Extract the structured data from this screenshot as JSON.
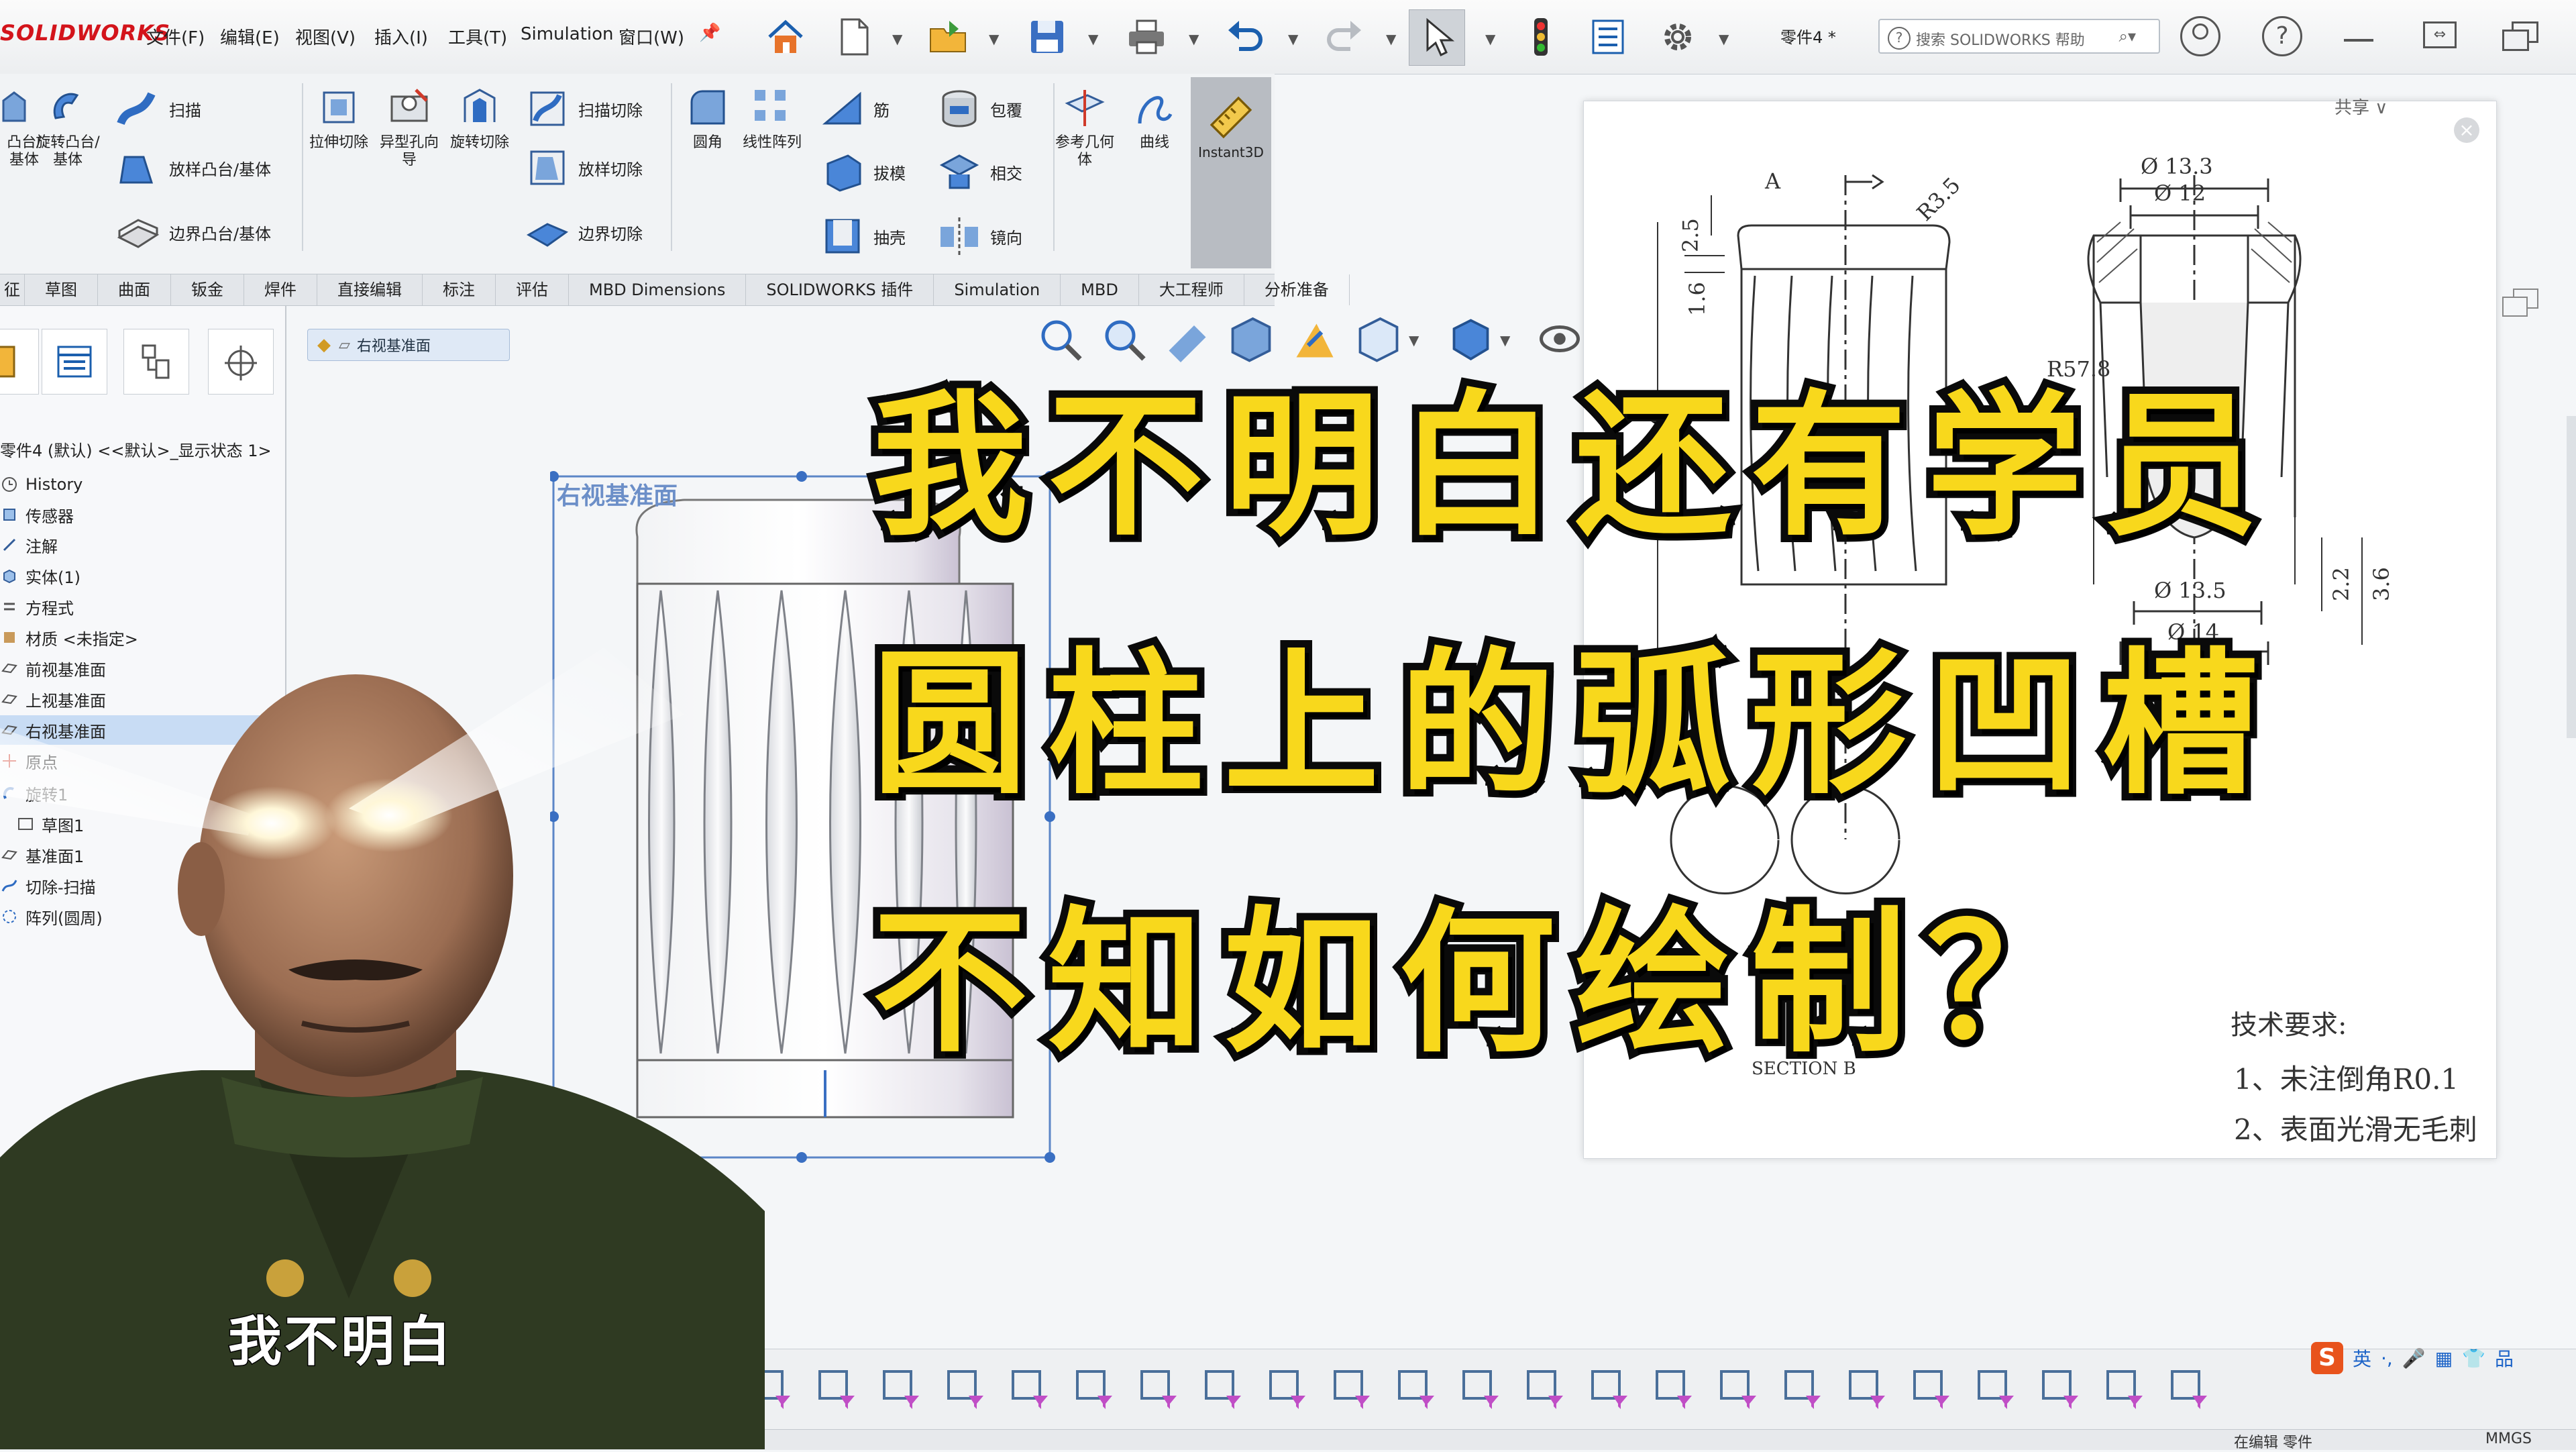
{
  "app": {
    "logo": "SOLIDWORKS",
    "menu": [
      "文件(F)",
      "编辑(E)",
      "视图(V)",
      "插入(I)",
      "工具(T)",
      "Simulation",
      "窗口(W)"
    ],
    "document_name": "零件4 *",
    "search_placeholder": "搜索 SOLIDWORKS 帮助"
  },
  "command_manager": {
    "features": [
      "扫描",
      "放样凸台/基体",
      "边界凸台/基体",
      "拉伸切除",
      "异型孔向导",
      "旋转切除",
      "扫描切除",
      "放样切除",
      "边界切除",
      "圆角",
      "线性阵列",
      "筋",
      "拔模",
      "抽壳",
      "包覆",
      "相交",
      "镜向",
      "参考几何体",
      "曲线",
      "Instant3D"
    ],
    "left_partial": [
      "凸台/基体",
      "旋转凸台/基体"
    ]
  },
  "tabs": [
    "特征",
    "草图",
    "曲面",
    "钣金",
    "焊件",
    "直接编辑",
    "标注",
    "评估",
    "MBD Dimensions",
    "SOLIDWORKS 插件",
    "Simulation",
    "MBD",
    "大工程师",
    "分析准备"
  ],
  "feature_tree": {
    "root": "零件4 (默认) <<默认>_显示状态 1>",
    "items": [
      "History",
      "传感器",
      "注解",
      "实体(1)",
      "方程式",
      "材质 <未指定>",
      "前视基准面",
      "上视基准面",
      "右视基准面",
      "原点",
      "旋转1",
      "草图1",
      "基准面1",
      "切除-扫描",
      "阵列(圆周)"
    ]
  },
  "graphics": {
    "breadcrumb": "右视基准面",
    "plane_label": "右视基准面"
  },
  "drawing": {
    "share": "共享 ∨",
    "dims": [
      "Ø 13.3",
      "Ø 12",
      "R3.5",
      "2.5",
      "1.6",
      "A",
      "R57.8",
      "Ø 13.5",
      "Ø 14",
      "2.2",
      "3.6",
      "SECTION B"
    ],
    "tech_title": "技术要求:",
    "tech_items": [
      "1、未注倒角R0.1",
      "2、表面光滑无毛刺"
    ]
  },
  "overlay": {
    "lines": [
      "我不明白还有学员",
      "圆柱上的弧形凹槽",
      "不知如何绘制？"
    ],
    "color": "#f8d81c"
  },
  "meme": {
    "subtitle": "我不明白"
  },
  "ime": {
    "items": [
      "S",
      "英",
      "·,",
      "🎤",
      "▦",
      "👕",
      "品"
    ]
  },
  "status": {
    "left": "在编辑 零件",
    "right": "MMGS"
  }
}
